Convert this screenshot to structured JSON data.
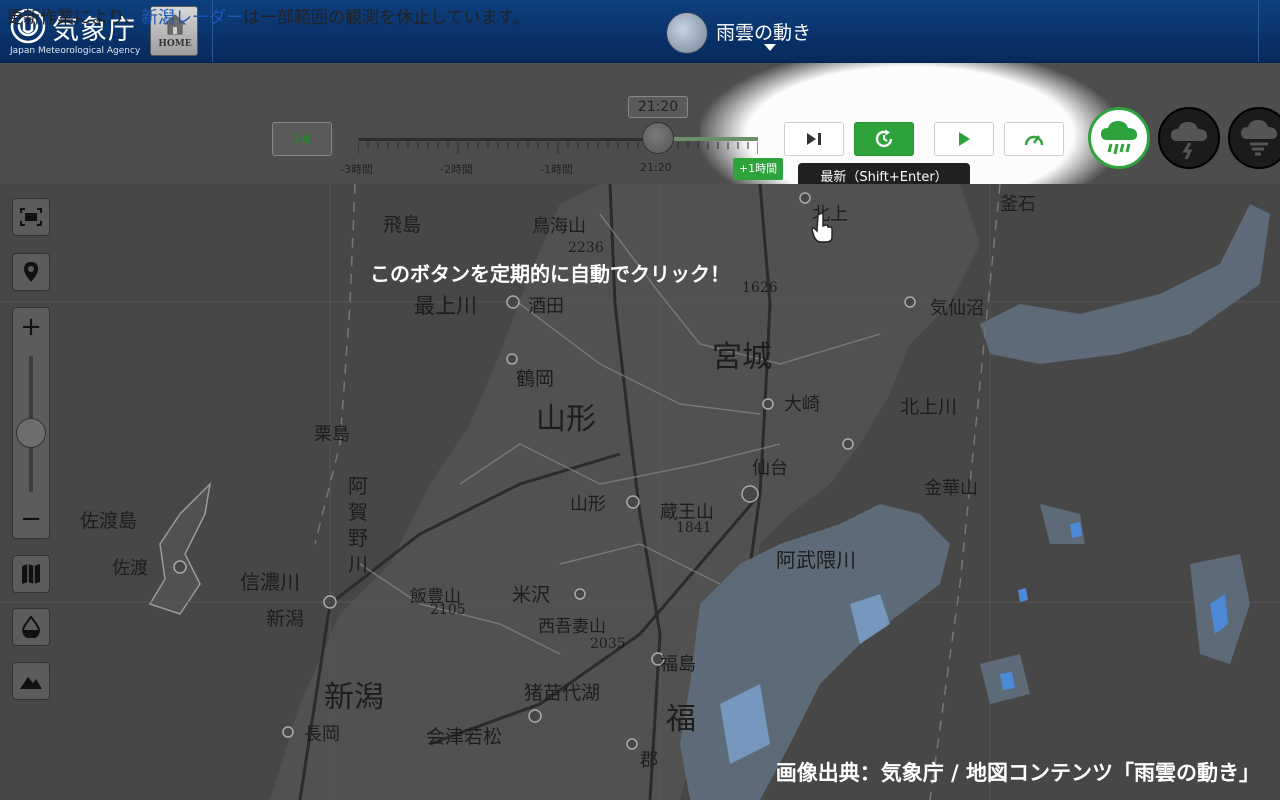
{
  "header": {
    "logo_name": "気象庁",
    "logo_sub": "Japan Meteorological Agency",
    "home_label": "HOME",
    "title": "雨雲の動き"
  },
  "notice": {
    "before": "更新作業により、",
    "link": "新潟レーダー",
    "after": "は一部範囲の観測を休止しています。"
  },
  "timeline": {
    "current_time": "21:20",
    "labels": [
      "-3時間",
      "-2時間",
      "-1時間",
      "21:20"
    ],
    "forecast_badge": "+1時間",
    "position": 0.75
  },
  "controls": {
    "latest_tooltip": "最新（Shift+Enter）"
  },
  "map": {
    "labels": [
      {
        "text": "飛島",
        "size": 19
      },
      {
        "text": "鳥海山",
        "size": 18
      },
      {
        "text": "2236",
        "size": 14
      },
      {
        "text": "1626",
        "size": 14
      },
      {
        "text": "北上",
        "size": 18
      },
      {
        "text": "釜石",
        "size": 18
      },
      {
        "text": "最上川",
        "size": 21
      },
      {
        "text": "酒田",
        "size": 18
      },
      {
        "text": "気仙沼",
        "size": 18
      },
      {
        "text": "宮城",
        "size": 30
      },
      {
        "text": "鶴岡",
        "size": 19
      },
      {
        "text": "大崎",
        "size": 18
      },
      {
        "text": "山形",
        "size": 30
      },
      {
        "text": "北上川",
        "size": 19
      },
      {
        "text": "栗島",
        "size": 18
      },
      {
        "text": "仙台",
        "size": 18
      },
      {
        "text": "阿",
        "size": 20
      },
      {
        "text": "賀",
        "size": 20
      },
      {
        "text": "野",
        "size": 20
      },
      {
        "text": "川",
        "size": 20
      },
      {
        "text": "金華山",
        "size": 18
      },
      {
        "text": "佐渡島",
        "size": 19
      },
      {
        "text": "山形",
        "size": 18
      },
      {
        "text": "蔵王山",
        "size": 18
      },
      {
        "text": "1841",
        "size": 14
      },
      {
        "text": "佐渡",
        "size": 18
      },
      {
        "text": "阿武隈川",
        "size": 20
      },
      {
        "text": "信濃川",
        "size": 20
      },
      {
        "text": "米沢",
        "size": 19
      },
      {
        "text": "飯豊山",
        "size": 17
      },
      {
        "text": "2105",
        "size": 14
      },
      {
        "text": "新潟",
        "size": 19
      },
      {
        "text": "西吾妻山",
        "size": 17
      },
      {
        "text": "2035",
        "size": 14
      },
      {
        "text": "福島",
        "size": 18
      },
      {
        "text": "新潟",
        "size": 30
      },
      {
        "text": "猪苗代湖",
        "size": 19
      },
      {
        "text": "長岡",
        "size": 18
      },
      {
        "text": "会津若松",
        "size": 19
      },
      {
        "text": "福",
        "size": 30
      },
      {
        "text": "郡",
        "size": 18
      }
    ]
  },
  "annotation": "このボタンを定期的に自動でクリック！",
  "credit": "画像出典：気象庁 / 地図コンテンツ「雨雲の動き」",
  "accent": "#2ea33c"
}
